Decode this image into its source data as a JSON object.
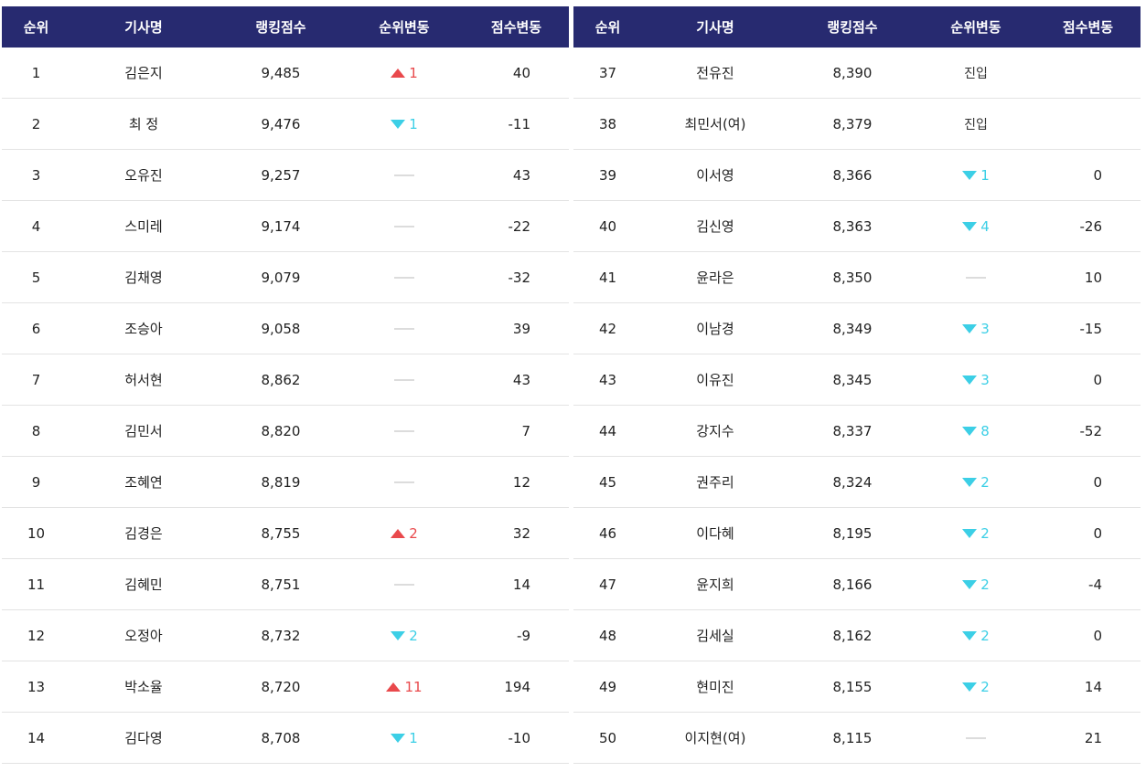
{
  "headers": [
    "순위",
    "기사명",
    "랭킹점수",
    "순위변동",
    "점수변동"
  ],
  "left_rows": [
    {
      "rank": "1",
      "name": "김은지",
      "score": "9,485",
      "change_dir": "up",
      "change": "1",
      "delta": "40"
    },
    {
      "rank": "2",
      "name": "최 정",
      "score": "9,476",
      "change_dir": "down",
      "change": "1",
      "delta": "-11"
    },
    {
      "rank": "3",
      "name": "오유진",
      "score": "9,257",
      "change_dir": "same",
      "change": "",
      "delta": "43"
    },
    {
      "rank": "4",
      "name": "스미레",
      "score": "9,174",
      "change_dir": "same",
      "change": "",
      "delta": "-22"
    },
    {
      "rank": "5",
      "name": "김채영",
      "score": "9,079",
      "change_dir": "same",
      "change": "",
      "delta": "-32"
    },
    {
      "rank": "6",
      "name": "조승아",
      "score": "9,058",
      "change_dir": "same",
      "change": "",
      "delta": "39"
    },
    {
      "rank": "7",
      "name": "허서현",
      "score": "8,862",
      "change_dir": "same",
      "change": "",
      "delta": "43"
    },
    {
      "rank": "8",
      "name": "김민서",
      "score": "8,820",
      "change_dir": "same",
      "change": "",
      "delta": "7"
    },
    {
      "rank": "9",
      "name": "조혜연",
      "score": "8,819",
      "change_dir": "same",
      "change": "",
      "delta": "12"
    },
    {
      "rank": "10",
      "name": "김경은",
      "score": "8,755",
      "change_dir": "up",
      "change": "2",
      "delta": "32"
    },
    {
      "rank": "11",
      "name": "김혜민",
      "score": "8,751",
      "change_dir": "same",
      "change": "",
      "delta": "14"
    },
    {
      "rank": "12",
      "name": "오정아",
      "score": "8,732",
      "change_dir": "down",
      "change": "2",
      "delta": "-9"
    },
    {
      "rank": "13",
      "name": "박소율",
      "score": "8,720",
      "change_dir": "up",
      "change": "11",
      "delta": "194"
    },
    {
      "rank": "14",
      "name": "김다영",
      "score": "8,708",
      "change_dir": "down",
      "change": "1",
      "delta": "-10"
    }
  ],
  "right_rows": [
    {
      "rank": "37",
      "name": "전유진",
      "score": "8,390",
      "change_dir": "new",
      "change": "진입",
      "delta": ""
    },
    {
      "rank": "38",
      "name": "최민서(여)",
      "score": "8,379",
      "change_dir": "new",
      "change": "진입",
      "delta": ""
    },
    {
      "rank": "39",
      "name": "이서영",
      "score": "8,366",
      "change_dir": "down",
      "change": "1",
      "delta": "0"
    },
    {
      "rank": "40",
      "name": "김신영",
      "score": "8,363",
      "change_dir": "down",
      "change": "4",
      "delta": "-26"
    },
    {
      "rank": "41",
      "name": "윤라은",
      "score": "8,350",
      "change_dir": "same",
      "change": "",
      "delta": "10"
    },
    {
      "rank": "42",
      "name": "이남경",
      "score": "8,349",
      "change_dir": "down",
      "change": "3",
      "delta": "-15"
    },
    {
      "rank": "43",
      "name": "이유진",
      "score": "8,345",
      "change_dir": "down",
      "change": "3",
      "delta": "0"
    },
    {
      "rank": "44",
      "name": "강지수",
      "score": "8,337",
      "change_dir": "down",
      "change": "8",
      "delta": "-52"
    },
    {
      "rank": "45",
      "name": "권주리",
      "score": "8,324",
      "change_dir": "down",
      "change": "2",
      "delta": "0"
    },
    {
      "rank": "46",
      "name": "이다혜",
      "score": "8,195",
      "change_dir": "down",
      "change": "2",
      "delta": "0"
    },
    {
      "rank": "47",
      "name": "윤지희",
      "score": "8,166",
      "change_dir": "down",
      "change": "2",
      "delta": "-4"
    },
    {
      "rank": "48",
      "name": "김세실",
      "score": "8,162",
      "change_dir": "down",
      "change": "2",
      "delta": "0"
    },
    {
      "rank": "49",
      "name": "현미진",
      "score": "8,155",
      "change_dir": "down",
      "change": "2",
      "delta": "14"
    },
    {
      "rank": "50",
      "name": "이지현(여)",
      "score": "8,115",
      "change_dir": "same",
      "change": "",
      "delta": "21"
    }
  ],
  "colors": {
    "header_bg": "#272a70",
    "up": "#e9494c",
    "down": "#3ccfe6",
    "divider": "#e3e3e3"
  },
  "icons": {
    "up": "triangle-up-icon",
    "down": "triangle-down-icon",
    "same": "dash-icon"
  }
}
